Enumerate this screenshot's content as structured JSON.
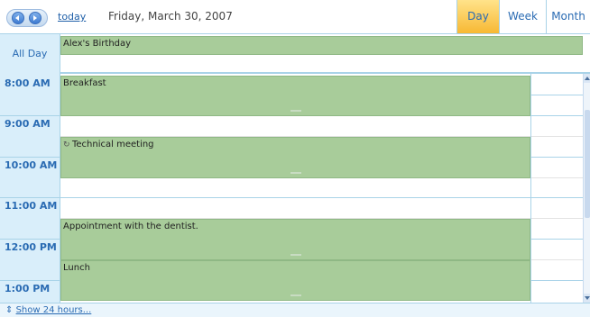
{
  "toolbar": {
    "today_label": "today",
    "date_label": "Friday, March 30, 2007",
    "views": [
      "Day",
      "Week",
      "Month"
    ],
    "active_view": "Day"
  },
  "allday": {
    "label": "All Day",
    "event": "Alex's Birthday"
  },
  "times": [
    "8:00 AM",
    "9:00 AM",
    "10:00 AM",
    "11:00 AM",
    "12:00 PM",
    "1:00 PM"
  ],
  "events": [
    {
      "title": "Breakfast",
      "icon": ""
    },
    {
      "title": "Technical meeting",
      "icon": "recurring-icon"
    },
    {
      "title": "Appointment with the dentist.",
      "icon": ""
    },
    {
      "title": "Lunch",
      "icon": ""
    }
  ],
  "footer": {
    "link": "Show 24 hours...",
    "icon": "expand-icon"
  },
  "colors": {
    "event": "#a8cc9a",
    "accent": "#2a6bb3",
    "gutter": "#d9eefa",
    "active_tab": "#f7b833"
  }
}
